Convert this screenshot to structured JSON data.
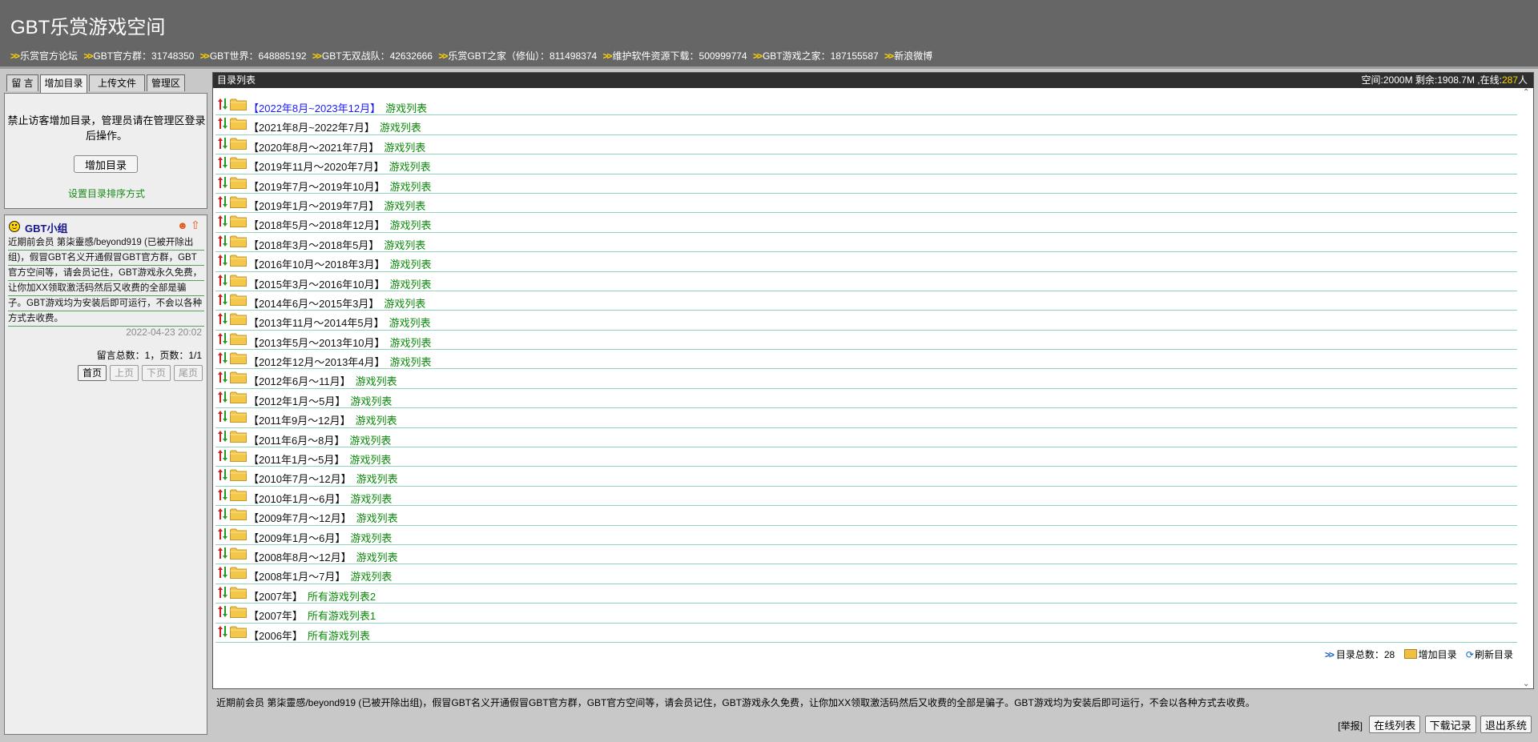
{
  "header": {
    "title": "GBT乐赏游戏空间",
    "links": [
      "乐赏官方论坛",
      "GBT官方群：31748350",
      "GBT世界：648885192",
      "GBT无双战队：42632666",
      "乐赏GBT之家（修仙）：811498374",
      "维护软件资源下载：500999774",
      "GBT游戏之家：187155587",
      "新浪微博"
    ]
  },
  "tabs": [
    "留 言",
    "增加目录",
    "上传文件",
    "管理区"
  ],
  "add_panel": {
    "notice": "禁止访客增加目录，管理员请在管理区登录后操作。",
    "button": "增加目录",
    "sort_link": "设置目录排序方式"
  },
  "message": {
    "author": "GBT小组",
    "body": "近期前会员 第柒靈感/beyond919 (已被开除出组)，假冒GBT名义开通假冒GBT官方群，GBT官方空间等，请会员记住，GBT游戏永久免费，让你加XX领取激活码然后又收费的全部是骗子。GBT游戏均为安装后即可运行，不会以各种方式去收费。",
    "time": "2022-04-23 20:02",
    "stats": "留言总数：1，页数：1/1",
    "pager": [
      "首页",
      "上页",
      "下页",
      "尾页"
    ]
  },
  "main": {
    "title": "目录列表",
    "space_prefix": "空间:2000M 剩余:1908.7M ,在线:",
    "online": "287",
    "space_suffix": "人",
    "directories": [
      {
        "name": "【2022年8月~2023年12月】",
        "link": "游戏列表"
      },
      {
        "name": "【2021年8月~2022年7月】",
        "link": "游戏列表"
      },
      {
        "name": "【2020年8月～2021年7月】",
        "link": "游戏列表"
      },
      {
        "name": "【2019年11月～2020年7月】",
        "link": "游戏列表"
      },
      {
        "name": "【2019年7月～2019年10月】",
        "link": "游戏列表"
      },
      {
        "name": "【2019年1月～2019年7月】",
        "link": "游戏列表"
      },
      {
        "name": "【2018年5月～2018年12月】",
        "link": "游戏列表"
      },
      {
        "name": "【2018年3月～2018年5月】",
        "link": "游戏列表"
      },
      {
        "name": "【2016年10月～2018年3月】",
        "link": "游戏列表"
      },
      {
        "name": "【2015年3月～2016年10月】",
        "link": "游戏列表"
      },
      {
        "name": "【2014年6月～2015年3月】",
        "link": "游戏列表"
      },
      {
        "name": "【2013年11月～2014年5月】",
        "link": "游戏列表"
      },
      {
        "name": "【2013年5月～2013年10月】",
        "link": "游戏列表"
      },
      {
        "name": "【2012年12月～2013年4月】",
        "link": "游戏列表"
      },
      {
        "name": "【2012年6月～11月】",
        "link": "游戏列表"
      },
      {
        "name": "【2012年1月～5月】",
        "link": "游戏列表"
      },
      {
        "name": "【2011年9月～12月】",
        "link": "游戏列表"
      },
      {
        "name": "【2011年6月～8月】",
        "link": "游戏列表"
      },
      {
        "name": "【2011年1月～5月】",
        "link": "游戏列表"
      },
      {
        "name": "【2010年7月～12月】",
        "link": "游戏列表"
      },
      {
        "name": "【2010年1月～6月】",
        "link": "游戏列表"
      },
      {
        "name": "【2009年7月～12月】",
        "link": "游戏列表"
      },
      {
        "name": "【2009年1月～6月】",
        "link": "游戏列表"
      },
      {
        "name": "【2008年8月～12月】",
        "link": "游戏列表"
      },
      {
        "name": "【2008年1月～7月】",
        "link": "游戏列表"
      },
      {
        "name": "【2007年】",
        "link": "所有游戏列表2"
      },
      {
        "name": "【2007年】",
        "link": "所有游戏列表1"
      },
      {
        "name": "【2006年】",
        "link": "所有游戏列表"
      }
    ],
    "footer": {
      "count_label": "目录总数：",
      "count": "28",
      "add": "增加目录",
      "refresh": "刷新目录"
    }
  },
  "bottom": {
    "notice": "近期前会员 第柒靈感/beyond919 (已被开除出组)，假冒GBT名义开通假冒GBT官方群，GBT官方空间等，请会员记住，GBT游戏永久免费，让你加XX领取激活码然后又收费的全部是骗子。GBT游戏均为安装后即可运行，不会以各种方式去收费。",
    "report": "[举报]",
    "buttons": [
      "在线列表",
      "下载记录",
      "退出系统"
    ]
  },
  "colors": {
    "header_bg": "#666666",
    "link_arrow": "#ffd400",
    "list_link": "#0a8a0a",
    "row_divider": "#8fd3bf",
    "online": "#ffd400"
  }
}
